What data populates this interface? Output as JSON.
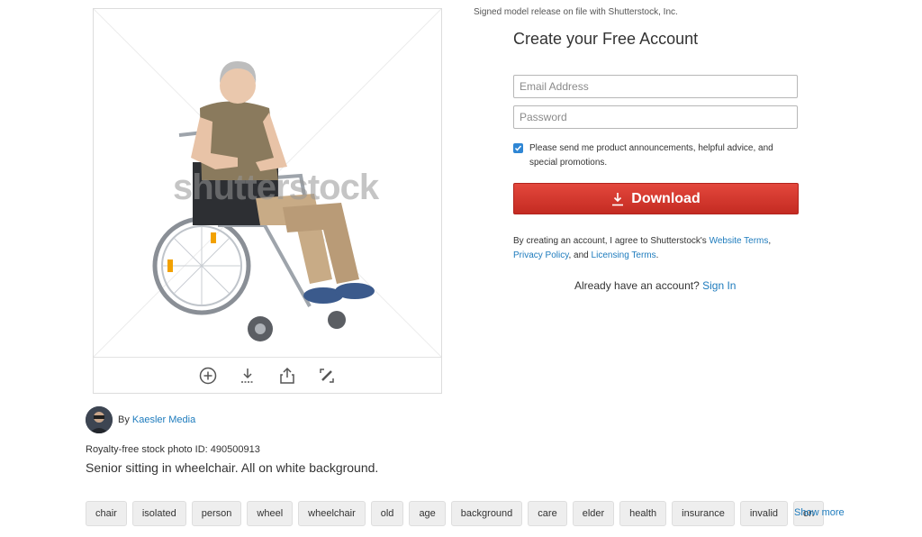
{
  "image": {
    "watermark": "shutterstock",
    "toolbar": [
      "add-to-lightbox",
      "download",
      "share",
      "edit"
    ]
  },
  "author": {
    "prefix": "By",
    "name": "Kaesler Media"
  },
  "photo_id_text": "Royalty-free stock photo ID: 490500913",
  "description": "Senior sitting in wheelchair. All on white background.",
  "tags": [
    "chair",
    "isolated",
    "person",
    "wheel",
    "wheelchair",
    "old",
    "age",
    "background",
    "care",
    "elder",
    "health",
    "insurance",
    "invalid",
    "on"
  ],
  "show_more": "Show more",
  "right_panel": {
    "release_note": "Signed model release on file with Shutterstock, Inc.",
    "heading": "Create your Free Account",
    "email_placeholder": "Email Address",
    "password_placeholder": "Password",
    "opt_in_checked": true,
    "opt_in_label": "Please send me product announcements, helpful advice, and special promotions.",
    "download_label": "Download",
    "terms_prefix": "By creating an account, I agree to Shutterstock's",
    "terms_link": "Website Terms",
    "terms_sep": ",",
    "privacy_link": "Privacy Policy",
    "terms_and": ", and",
    "licensing_link": "Licensing Terms",
    "terms_end": ".",
    "signin_prompt": "Already have an account?",
    "signin_link": "Sign In"
  },
  "colors": {
    "link": "#1d7bbd",
    "download_button": "#d6362c",
    "checkbox": "#2f86d4"
  }
}
